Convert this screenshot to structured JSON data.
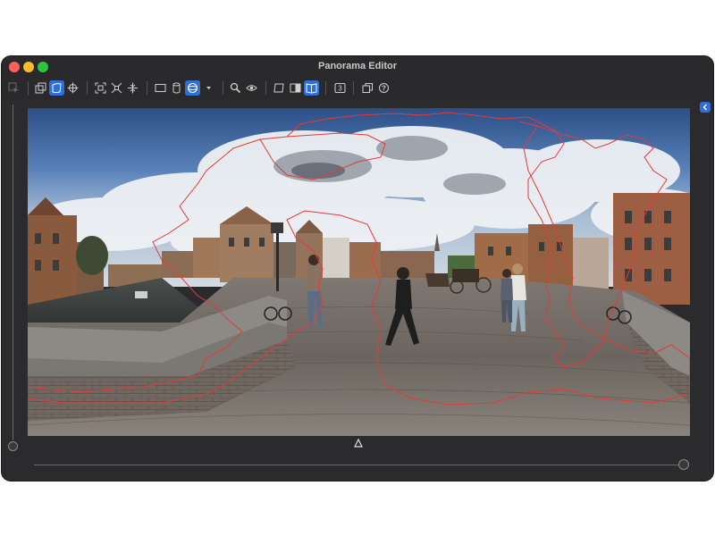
{
  "window": {
    "title": "Panorama Editor"
  },
  "toolbar": {
    "tools": [
      {
        "name": "select-arrow-icon",
        "active": false
      },
      {
        "name": "layers-icon",
        "active": false
      },
      {
        "name": "warp-icon",
        "active": true
      },
      {
        "name": "crosshair-icon",
        "active": false
      },
      {
        "name": "fit-icon",
        "active": false
      },
      {
        "name": "shrink-icon",
        "active": false
      },
      {
        "name": "center-icon",
        "active": false
      },
      {
        "name": "rectilinear-icon",
        "active": false
      },
      {
        "name": "cylindrical-icon",
        "active": false
      },
      {
        "name": "spherical-icon",
        "active": true
      },
      {
        "name": "projection-dropdown-icon",
        "active": false
      },
      {
        "name": "zoom-icon",
        "active": false
      },
      {
        "name": "preview-eye-icon",
        "active": false
      },
      {
        "name": "mask-left-icon",
        "active": false
      },
      {
        "name": "mask-split-icon",
        "active": false
      },
      {
        "name": "mask-book-icon",
        "active": true
      },
      {
        "name": "numbered-badge-icon",
        "active": false
      },
      {
        "name": "duplicate-icon",
        "active": false
      },
      {
        "name": "help-icon",
        "active": false
      }
    ],
    "badge_text": "3",
    "help_text": "?",
    "accent": "#2f6fd8"
  },
  "colors": {
    "window_bg": "#2a2a2c",
    "mask_outline": "#e23b3b"
  }
}
